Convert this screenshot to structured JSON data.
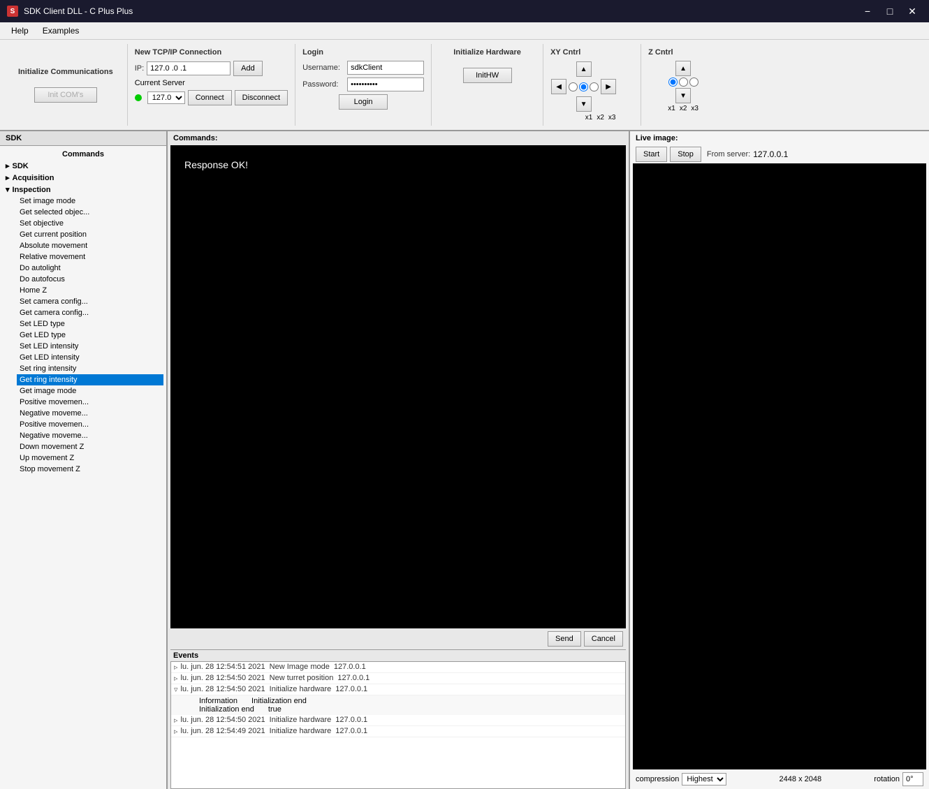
{
  "window": {
    "title": "SDK Client DLL - C Plus Plus",
    "icon": "S"
  },
  "menu": {
    "items": [
      "Help",
      "Examples"
    ]
  },
  "init_com": {
    "section_title": "Initialize Communications",
    "button_label": "Init COM's"
  },
  "tcp": {
    "section_title": "New TCP/IP Connection",
    "ip_label": "IP:",
    "ip_value": "127.0 .0 .1",
    "add_label": "Add",
    "current_server_label": "Current Server",
    "server_value": "127.0",
    "connect_label": "Connect",
    "disconnect_label": "Disconnect"
  },
  "login": {
    "section_title": "Login",
    "username_label": "Username:",
    "username_value": "sdkClient",
    "password_label": "Password:",
    "password_value": "••••••••••",
    "login_label": "Login"
  },
  "hw": {
    "section_title": "Initialize Hardware",
    "button_label": "InitHW"
  },
  "xy": {
    "section_title": "XY Cntrl",
    "options": [
      "x1",
      "x2",
      "x3"
    ]
  },
  "z": {
    "section_title": "Z Cntrl",
    "options": [
      "x1",
      "x2",
      "x3"
    ]
  },
  "sdk_panel": {
    "label": "SDK",
    "commands_label": "Commands",
    "tree": [
      {
        "id": "sdk",
        "label": "SDK",
        "expanded": false,
        "children": []
      },
      {
        "id": "acquisition",
        "label": "Acquisition",
        "expanded": false,
        "children": []
      },
      {
        "id": "inspection",
        "label": "Inspection",
        "expanded": true,
        "children": [
          "Set image mode",
          "Get selected objec...",
          "Set objective",
          "Get current position",
          "Absolute movement",
          "Relative movement",
          "Do autolight",
          "Do autofocus",
          "Home Z",
          "Set camera config...",
          "Get camera config...",
          "Set LED type",
          "Get LED type",
          "Set LED intensity",
          "Get LED intensity",
          "Set ring intensity",
          "Get ring intensity",
          "Get image mode",
          "Positive movemen...",
          "Negative moveme...",
          "Positive movemen...",
          "Negative moveme...",
          "Down movement Z",
          "Up movement Z",
          "Stop movement Z"
        ]
      }
    ]
  },
  "commands": {
    "label": "Commands:",
    "response_text": "Response OK!",
    "send_label": "Send",
    "cancel_label": "Cancel"
  },
  "events": {
    "label": "Events",
    "rows": [
      {
        "expand": "▷",
        "time": "lu. jun. 28 12:54:51 2021",
        "name": "New Image mode",
        "server": "127.0.0.1",
        "expanded": false
      },
      {
        "expand": "▷",
        "time": "lu. jun. 28 12:54:50 2021",
        "name": "New turret position",
        "server": "127.0.0.1",
        "expanded": false
      },
      {
        "expand": "▽",
        "time": "lu. jun. 28 12:54:50 2021",
        "name": "Initialize hardware",
        "server": "127.0.0.1",
        "expanded": true,
        "details": [
          {
            "key": "Information",
            "value": "Initialization end"
          },
          {
            "key": "Initialization end",
            "value": "true"
          }
        ]
      },
      {
        "expand": "▷",
        "time": "lu. jun. 28 12:54:50 2021",
        "name": "Initialize hardware",
        "server": "127.0.0.1",
        "expanded": false
      },
      {
        "expand": "▷",
        "time": "lu. jun. 28 12:54:49 2021",
        "name": "Initialize hardware",
        "server": "127.0.0.1",
        "expanded": false
      }
    ]
  },
  "live": {
    "label": "Live image:",
    "start_label": "Start",
    "stop_label": "Stop",
    "from_server_label": "From server:",
    "from_server_value": "127.0.0.1",
    "dimensions": "2448 x 2048",
    "rotation_label": "rotation",
    "rotation_value": "0°",
    "compression_label": "compression",
    "compression_value": "Highest"
  }
}
